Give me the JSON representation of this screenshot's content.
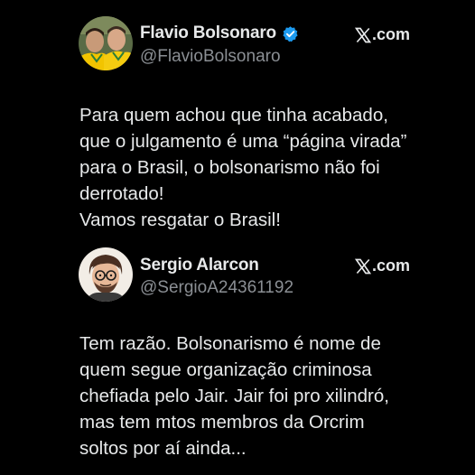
{
  "tweets": [
    {
      "author": {
        "display_name": "Flavio Bolsonaro",
        "handle": "@FlavioBolsonaro",
        "verified": true,
        "avatar": "photo-avatar-two-men"
      },
      "source_label": ".com",
      "source_icon": "x-logo-icon",
      "text": "Para quem achou que tinha acabado,\nque o julgamento é uma “página virada”\npara o Brasil, o bolsonarismo não foi\nderrotado!\nVamos resgatar o Brasil!"
    },
    {
      "author": {
        "display_name": "Sergio Alarcon",
        "handle": "@SergioA24361192",
        "verified": false,
        "avatar": "cartoon-avatar-man-glasses"
      },
      "source_label": ".com",
      "source_icon": "x-logo-icon",
      "text": "Tem razão. Bolsonarismo é nome de\nquem segue organização criminosa\nchefiada pelo Jair. Jair foi pro xilindró,\nmas tem mtos membros da Orcrim\nsoltos por aí ainda..."
    }
  ],
  "colors": {
    "background": "#000000",
    "text": "#e7e9ea",
    "secondary_text": "#8b8f94",
    "verified_badge": "#1d9bf0"
  }
}
